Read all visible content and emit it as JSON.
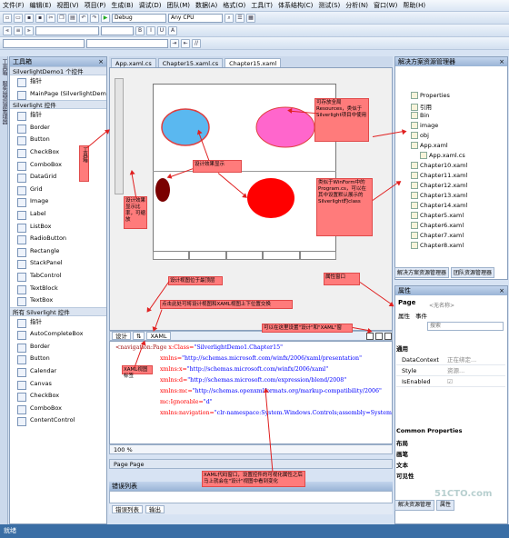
{
  "menu": [
    "文件(F)",
    "编辑(E)",
    "视图(V)",
    "项目(P)",
    "生成(B)",
    "调试(D)",
    "团队(M)",
    "数据(A)",
    "格式(O)",
    "工具(T)",
    "体系结构(C)",
    "测试(S)",
    "分析(N)",
    "窗口(W)",
    "帮助(H)"
  ],
  "toolbar": {
    "config": "Debug",
    "platform": "Any CPU"
  },
  "left_strip": [
    "工具箱",
    "服务器资源管理器"
  ],
  "toolbox": {
    "title": "工具箱",
    "group1": "SilverlightDemo1 个控件",
    "group1_items": [
      "指针",
      "MainPage (SilverlightDemo1)"
    ],
    "group2": "Silverlight 控件",
    "group2_items": [
      "指针",
      "Border",
      "Button",
      "CheckBox",
      "ComboBox",
      "DataGrid",
      "Grid",
      "Image",
      "Label",
      "ListBox",
      "RadioButton",
      "Rectangle",
      "StackPanel",
      "TabControl",
      "TextBlock",
      "TextBox"
    ],
    "group3": "所有 Silverlight 控件",
    "group3_items": [
      "指针",
      "AutoCompleteBox",
      "Border",
      "Button",
      "Calendar",
      "Canvas",
      "CheckBox",
      "ComboBox",
      "ContentControl"
    ]
  },
  "tabs": [
    "App.xaml.cs",
    "Chapter15.xaml.cs",
    "Chapter15.xaml"
  ],
  "split": {
    "design": "设计",
    "xaml": "XAML"
  },
  "xaml_lines": [
    {
      "tag": "<navigation:Page",
      "attr": " x:Class=",
      "val": "\"SilverlightDemo1.Chapter15\""
    },
    {
      "tag": "",
      "attr": "xmlns=",
      "val": "\"http://schemas.microsoft.com/winfx/2006/xaml/presentation\""
    },
    {
      "tag": "",
      "attr": "xmlns:x=",
      "val": "\"http://schemas.microsoft.com/winfx/2006/xaml\""
    },
    {
      "tag": "",
      "attr": "xmlns:d=",
      "val": "\"http://schemas.microsoft.com/expression/blend/2008\""
    },
    {
      "tag": "",
      "attr": "xmlns:mc=",
      "val": "\"http://schemas.openxmlformats.org/markup-compatibility/2006\""
    },
    {
      "tag": "",
      "attr": "mc:Ignorable=",
      "val": "\"d\""
    },
    {
      "tag": "",
      "attr": "xmlns:navigation=",
      "val": "\"clr-namespace:System.Windows.Controls;assembly=System"
    }
  ],
  "zoom": "100 %",
  "page_bar": "Page Page",
  "error_list": {
    "title": "错误列表",
    "tabs": [
      "错误列表",
      "输出"
    ]
  },
  "solution": {
    "title": "解决方案资源管理器",
    "items": [
      "Properties",
      "引用",
      "Bin",
      "image",
      "obj",
      "App.xaml",
      "App.xaml.cs",
      "Chapter10.xaml",
      "Chapter11.xaml",
      "Chapter12.xaml",
      "Chapter13.xaml",
      "Chapter14.xaml",
      "Chapter5.xaml",
      "Chapter6.xaml",
      "Chapter7.xaml",
      "Chapter8.xaml"
    ],
    "tabs": [
      "解决方案资源管理器",
      "团队资源管理器"
    ]
  },
  "properties": {
    "title": "属性",
    "object": "Page",
    "object_sub": "<无名称>",
    "tabs": [
      "属性",
      "事件"
    ],
    "search": "搜索",
    "category": "通用",
    "rows": [
      {
        "name": "DataContext",
        "value": "正在绑定..."
      },
      {
        "name": "Style",
        "value": "资源..."
      },
      {
        "name": "IsEnabled",
        "value": ""
      }
    ],
    "common_header": "Common Properties",
    "cats": [
      "布局",
      "画笔",
      "文本",
      "可见性"
    ],
    "bottom_tabs": [
      "解决资源管理",
      "属性"
    ]
  },
  "status": "就绪",
  "watermark": "51CTO.com",
  "notes": {
    "toolbox": "工具箱",
    "design_effect": "设计效果显示",
    "resources": "可存放全局Resources，类似于Silverlight项目中使用",
    "program": "类似于WinForm中的Program.cs，可以在其中设置默认展示的Silverlight的class",
    "zoom": "设计效果显示比率，可缩放",
    "design_view": "设计视图位于最顶层",
    "split": "点击此处可将设计视图和XAML视图上下位置交换",
    "swap": "可以在这里设置\"设计\"和\"XAML\"窗",
    "xaml_tab": "XAML视图标签",
    "xaml_window": "XAML代码窗口，设置控件的可视化属性之后马上就会在\"设计\"视图中看到变化",
    "property_window": "属性窗口"
  }
}
